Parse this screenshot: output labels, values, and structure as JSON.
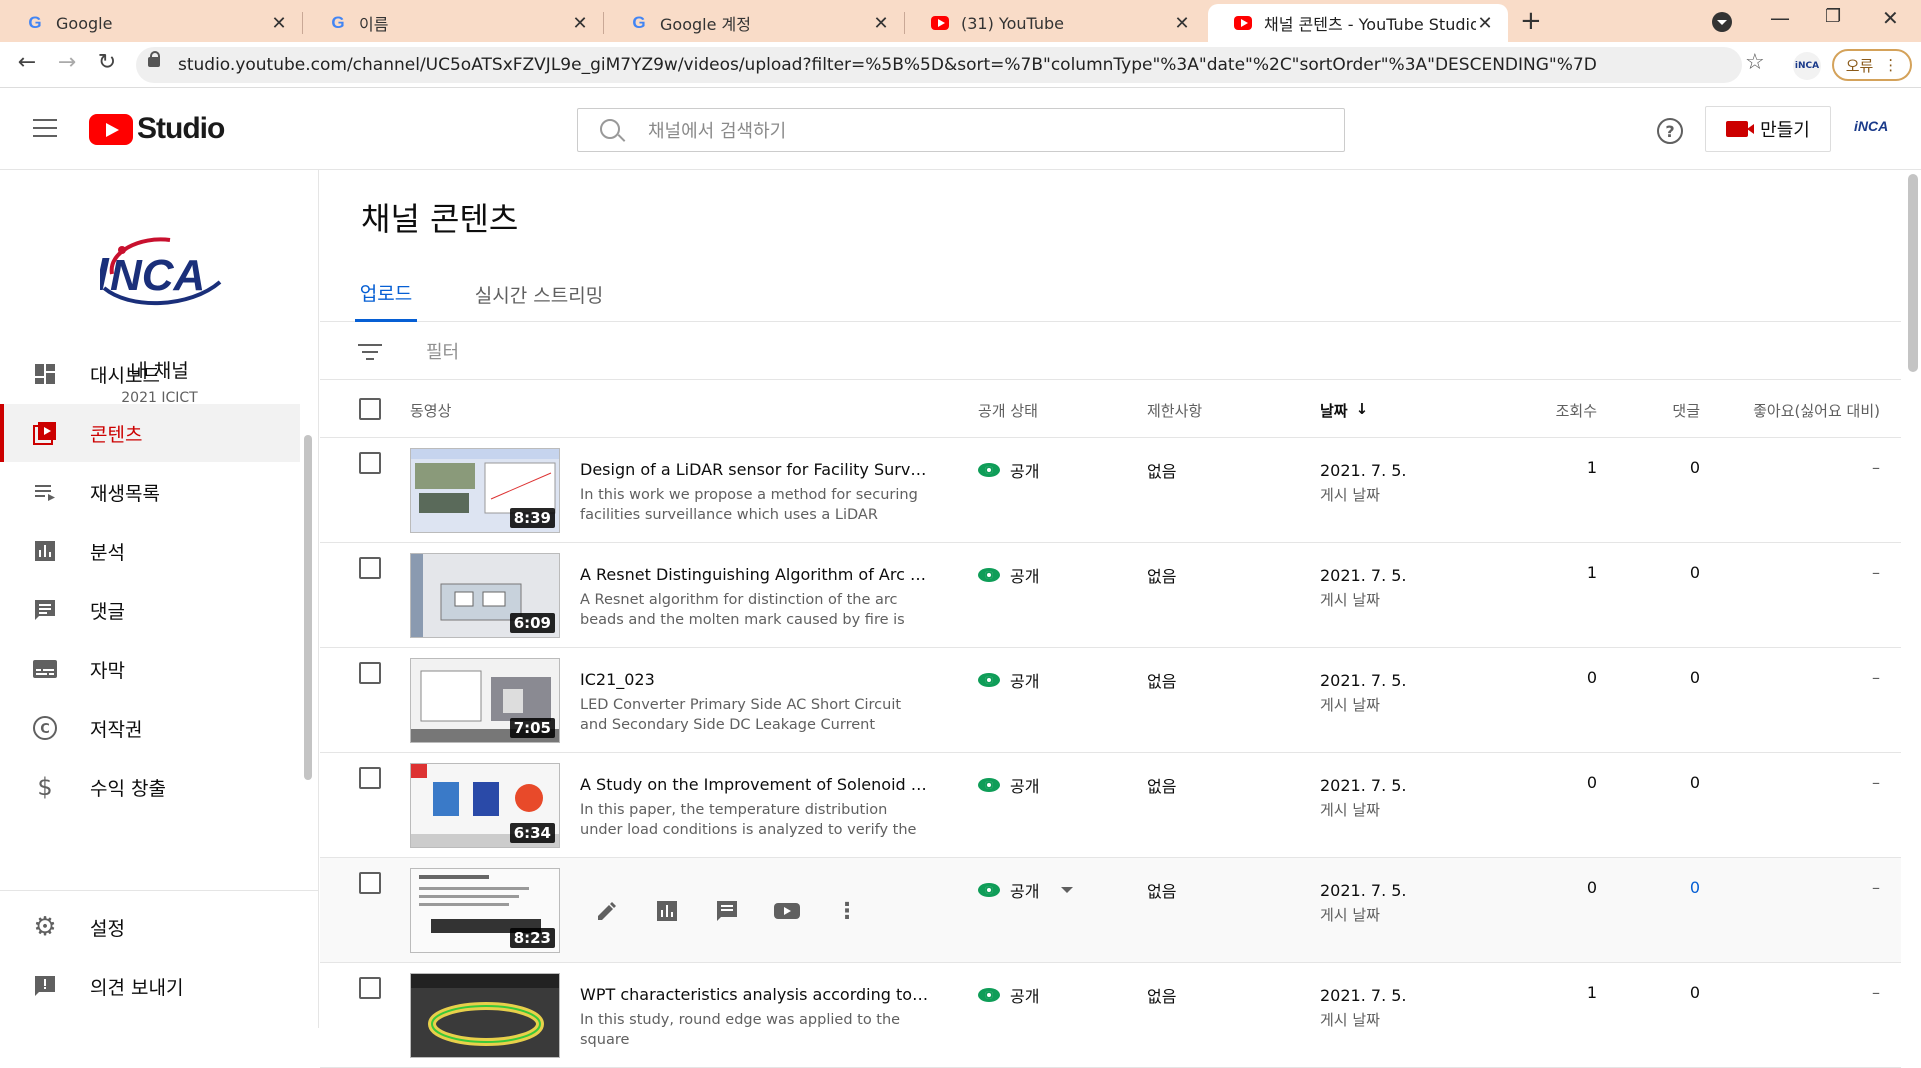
{
  "browser": {
    "tabs": [
      {
        "title": "Google",
        "icon": "google-icon"
      },
      {
        "title": "이름",
        "icon": "google-icon"
      },
      {
        "title": "Google 계정",
        "icon": "google-icon"
      },
      {
        "title": "(31) YouTube",
        "icon": "youtube-icon"
      },
      {
        "title": "채널 콘텐츠 - YouTube Studio",
        "icon": "youtube-icon"
      }
    ],
    "url": "studio.youtube.com/channel/UC5oATSxFZVJL9e_giM7YZ9w/videos/upload?filter=%5B%5D&sort=%7B\"columnType\"%3A\"date\"%2C\"sortOrder\"%3A\"DESCENDING\"%7D",
    "profile_badge": "iNCA",
    "error_label": "오류"
  },
  "header": {
    "logo_text": "Studio",
    "search_placeholder": "채널에서 검색하기",
    "create_label": "만들기",
    "avatar_text": "iNCA"
  },
  "sidebar": {
    "channel_logo_text": "iNCA",
    "channel_name": "내 채널",
    "channel_sub": "2021 ICICT",
    "items": [
      {
        "label": "대시보드",
        "icon": "dashboard-icon"
      },
      {
        "label": "콘텐츠",
        "icon": "content-icon",
        "active": true
      },
      {
        "label": "재생목록",
        "icon": "playlist-icon"
      },
      {
        "label": "분석",
        "icon": "analytics-icon"
      },
      {
        "label": "댓글",
        "icon": "comments-icon"
      },
      {
        "label": "자막",
        "icon": "subtitles-icon"
      },
      {
        "label": "저작권",
        "icon": "copyright-icon"
      },
      {
        "label": "수익 창출",
        "icon": "dollar-icon"
      }
    ],
    "bottom": [
      {
        "label": "설정",
        "icon": "gear-icon"
      },
      {
        "label": "의견 보내기",
        "icon": "feedback-icon"
      }
    ]
  },
  "main": {
    "title": "채널 콘텐츠",
    "tabs": [
      {
        "label": "업로드",
        "active": true
      },
      {
        "label": "실시간 스트리밍"
      }
    ],
    "filter_label": "필터",
    "columns": {
      "video": "동영상",
      "visibility": "공개 상태",
      "restrictions": "제한사항",
      "date": "날짜",
      "views": "조회수",
      "comments": "댓글",
      "likes": "좋아요(싫어요 대비)"
    },
    "rows": [
      {
        "duration": "8:39",
        "title": "Design of a LiDAR sensor for Facility Surveilla...",
        "desc": "In this work we propose a method for securing facilities surveillance which uses a LiDAR sensor...",
        "visibility": "공개",
        "restriction": "없음",
        "date": "2021. 7. 5.",
        "date_sub": "게시 날짜",
        "views": "1",
        "comments": "0",
        "likes": "–"
      },
      {
        "duration": "6:09",
        "title": "A Resnet Distinguishing Algorithm of Arc Bead...",
        "desc": "A Resnet algorithm for distinction of the arc beads and the molten mark caused by fire is proposed...",
        "visibility": "공개",
        "restriction": "없음",
        "date": "2021. 7. 5.",
        "date_sub": "게시 날짜",
        "views": "1",
        "comments": "0",
        "likes": "–"
      },
      {
        "duration": "7:05",
        "title": "IC21_023",
        "desc": "LED Converter Primary Side AC Short Circuit and Secondary Side DC Leakage Current Characteristi...",
        "visibility": "공개",
        "restriction": "없음",
        "date": "2021. 7. 5.",
        "date_sub": "게시 날짜",
        "views": "0",
        "comments": "0",
        "likes": "–"
      },
      {
        "duration": "6:34",
        "title": "A Study on the Improvement of Solenoid Valve...",
        "desc": "In this paper, the temperature distribution under load conditions is analyzed to verify the reliability...",
        "visibility": "공개",
        "restriction": "없음",
        "date": "2021. 7. 5.",
        "date_sub": "게시 날짜",
        "views": "0",
        "comments": "0",
        "likes": "–"
      },
      {
        "duration": "8:23",
        "title": "",
        "desc": "",
        "visibility": "공개",
        "restriction": "없음",
        "date": "2021. 7. 5.",
        "date_sub": "게시 날짜",
        "views": "0",
        "comments": "0",
        "likes": "–"
      },
      {
        "duration": "",
        "title": "WPT characteristics analysis according to the ...",
        "desc": "In this study, round edge was applied to the square",
        "visibility": "공개",
        "restriction": "없음",
        "date": "2021. 7. 5.",
        "date_sub": "게시 날짜",
        "views": "1",
        "comments": "0",
        "likes": "–"
      }
    ]
  }
}
